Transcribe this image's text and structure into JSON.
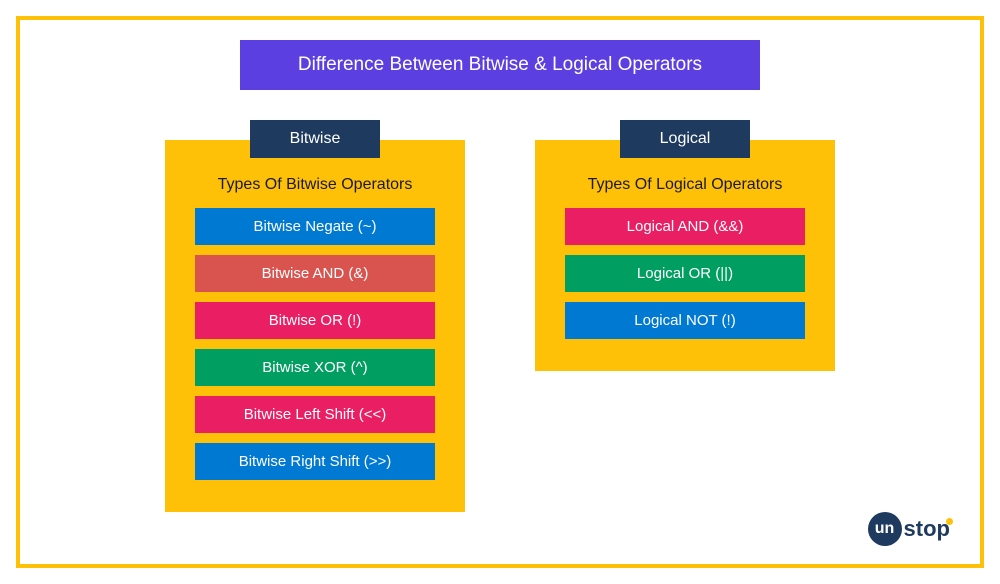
{
  "title": "Difference Between Bitwise & Logical Operators",
  "columns": {
    "bitwise": {
      "header": "Bitwise",
      "subheading": "Types Of Bitwise Operators",
      "items": [
        {
          "label": "Bitwise Negate (~)",
          "color": "blue"
        },
        {
          "label": "Bitwise AND (&)",
          "color": "salmon"
        },
        {
          "label": "Bitwise OR (!)",
          "color": "pink"
        },
        {
          "label": "Bitwise XOR (^)",
          "color": "green"
        },
        {
          "label": "Bitwise Left Shift (<<)",
          "color": "pink"
        },
        {
          "label": "Bitwise Right Shift (>>)",
          "color": "blue"
        }
      ]
    },
    "logical": {
      "header": "Logical",
      "subheading": "Types Of Logical Operators",
      "items": [
        {
          "label": "Logical AND (&&)",
          "color": "pink"
        },
        {
          "label": "Logical OR (||)",
          "color": "green"
        },
        {
          "label": "Logical NOT (!)",
          "color": "blue"
        }
      ]
    }
  },
  "brand": {
    "prefix": "un",
    "suffix": "stop"
  },
  "colors": {
    "frame": "#ffc107",
    "title_bg": "#5b3fe0",
    "header_bg": "#1e3a5f",
    "blue": "#0079d3",
    "salmon": "#d9544f",
    "pink": "#e91e63",
    "green": "#009e60"
  }
}
